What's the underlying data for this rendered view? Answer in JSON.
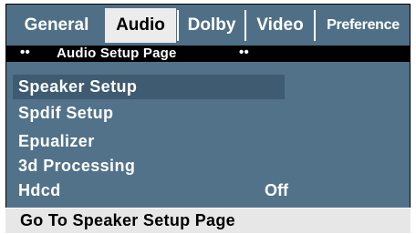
{
  "tabs": [
    {
      "label": "General"
    },
    {
      "label": "Audio"
    },
    {
      "label": "Dolby"
    },
    {
      "label": "Video"
    },
    {
      "label": "Preference"
    }
  ],
  "active_tab": "Audio",
  "header": {
    "left_marker": "••",
    "title": "Audio Setup Page",
    "right_marker": "••"
  },
  "menu": {
    "items": [
      {
        "label": "Speaker Setup",
        "value": ""
      },
      {
        "label": "Spdif Setup",
        "value": ""
      },
      {
        "label": "Epualizer",
        "value": ""
      },
      {
        "label": "3d Processing",
        "value": ""
      },
      {
        "label": "Hdcd",
        "value": "Off"
      }
    ],
    "selected_item": "Speaker Setup"
  },
  "status": {
    "text": "Go To Speaker Setup Page"
  },
  "colors": {
    "panel": "#52728a",
    "tab_bar": "#4f6f86",
    "selected_row": "#3e5b71",
    "active_tab": "#ececec",
    "header_bar": "#000000",
    "status_bar": "#e7e7e7"
  }
}
